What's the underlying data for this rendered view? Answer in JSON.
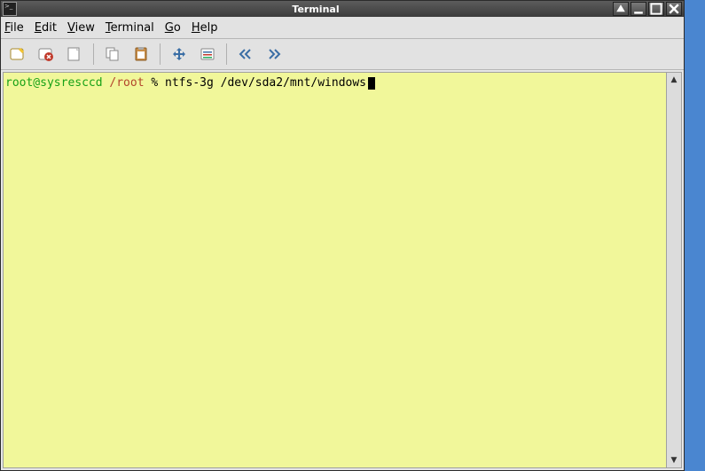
{
  "window": {
    "title": "Terminal"
  },
  "menu": {
    "file": "File",
    "edit": "Edit",
    "view": "View",
    "terminal": "Terminal",
    "go": "Go",
    "help": "Help"
  },
  "toolbar_icons": {
    "new_tab": "new-tab-icon",
    "close_tab": "close-tab-icon",
    "new_window": "new-window-icon",
    "copy": "copy-icon",
    "paste": "paste-icon",
    "fullscreen": "fullscreen-icon",
    "preferences": "preferences-icon",
    "prev_tab": "prev-tab-icon",
    "next_tab": "next-tab-icon"
  },
  "terminal": {
    "prompt_user": "root@sysresccd",
    "prompt_path": "/root",
    "prompt_symbol": "%",
    "command": "ntfs-3g /dev/sda2/mnt/windows"
  },
  "colors": {
    "term_bg": "#f1f79a",
    "prompt_user": "#17a117",
    "prompt_path": "#b2442b",
    "desktop_bg": "#4a86d0"
  }
}
